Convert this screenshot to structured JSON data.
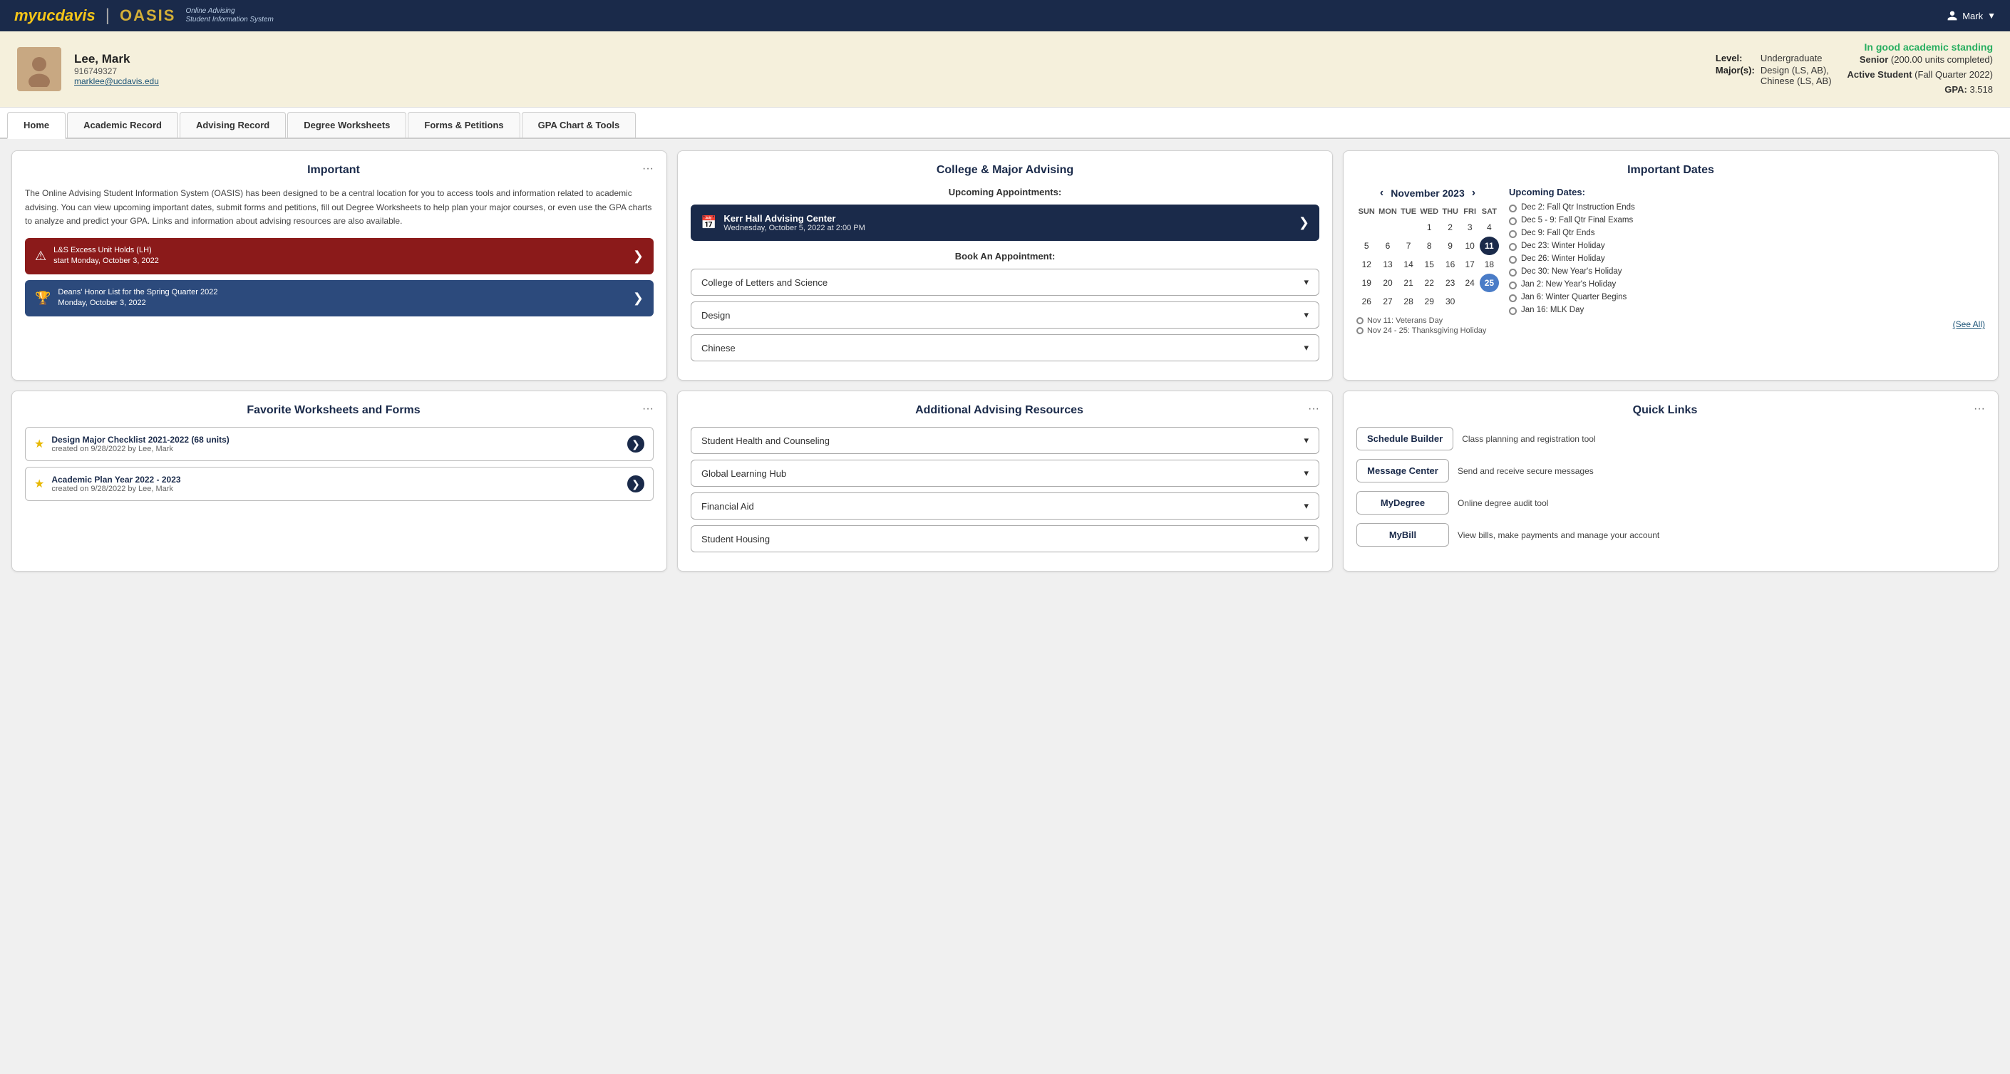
{
  "topnav": {
    "logo_my": "my",
    "logo_ucdavis": "ucdavis",
    "logo_oasis": "OASIS",
    "logo_subtitle_line1": "Online Advising",
    "logo_subtitle_line2": "Student Information System",
    "user_label": "Mark",
    "user_icon": "person-icon"
  },
  "profile": {
    "name": "Lee, Mark",
    "id": "916749327",
    "email": "marklee@ucdavis.edu",
    "level_label": "Level:",
    "level_value": "Undergraduate",
    "majors_label": "Major(s):",
    "majors_value1": "Design (LS, AB),",
    "majors_value2": "Chinese (LS, AB)",
    "standing": "In good academic standing",
    "year": "Senior",
    "units": "(200.00 units completed)",
    "active_label": "Active Student",
    "active_value": "(Fall Quarter 2022)",
    "gpa_label": "GPA:",
    "gpa_value": "3.518"
  },
  "tabs": [
    {
      "label": "Home",
      "active": true
    },
    {
      "label": "Academic Record",
      "active": false
    },
    {
      "label": "Advising Record",
      "active": false
    },
    {
      "label": "Degree Worksheets",
      "active": false
    },
    {
      "label": "Forms & Petitions",
      "active": false
    },
    {
      "label": "GPA Chart & Tools",
      "active": false
    }
  ],
  "important_card": {
    "title": "Important",
    "menu": "···",
    "body": "The Online Advising Student Information System (OASIS) has been designed to be a central location for you to access tools and information related to academic advising. You can view upcoming important dates, submit forms and petitions, fill out Degree Worksheets to help plan your major courses, or even use the GPA charts to analyze and predict your GPA. Links and information about advising resources are also available.",
    "alert_label": "L&S Excess Unit Holds (LH)",
    "alert_sub": "start Monday, October 3, 2022",
    "honor_label": "Deans' Honor List for the Spring Quarter 2022",
    "honor_sub": "Monday, October 3, 2022"
  },
  "college_advising": {
    "title": "College & Major Advising",
    "upcoming_title": "Upcoming Appointments:",
    "appointment_name": "Kerr Hall Advising Center",
    "appointment_date": "Wednesday, October 5, 2022 at 2:00 PM",
    "book_title": "Book An Appointment:",
    "dropdown1": "College of Letters and Science",
    "dropdown2": "Design",
    "dropdown3": "Chinese"
  },
  "important_dates": {
    "title": "Important Dates",
    "cal_month": "November 2023",
    "cal_days_header": [
      "SUN",
      "MON",
      "TUE",
      "WED",
      "THU",
      "FRI",
      "SAT"
    ],
    "cal_weeks": [
      [
        null,
        null,
        null,
        "1",
        "2",
        "3",
        "4",
        "5"
      ],
      [
        "6",
        "7",
        "8",
        "9",
        "10",
        "11",
        "12"
      ],
      [
        "13",
        "14",
        "15",
        "16",
        "17",
        "18",
        "19"
      ],
      [
        "20",
        "21",
        "22",
        "23",
        "24",
        "25",
        "26"
      ],
      [
        "27",
        "28",
        "29",
        "30",
        null,
        null,
        null
      ]
    ],
    "today": "11",
    "highlighted": "25",
    "holidays": [
      "Nov 11: Veterans Day",
      "Nov 24 - 25: Thanksgiving Holiday"
    ],
    "upcoming_title": "Upcoming Dates:",
    "upcoming_items": [
      "Dec 2: Fall Qtr Instruction Ends",
      "Dec 5 - 9: Fall Qtr Final Exams",
      "Dec 9: Fall Qtr Ends",
      "Dec 23: Winter Holiday",
      "Dec 26: Winter Holiday",
      "Dec 30: New Year's Holiday",
      "Jan 2: New Year's Holiday",
      "Jan 6: Winter Quarter Begins",
      "Jan 16: MLK Day"
    ],
    "see_all": "(See All)"
  },
  "worksheets": {
    "title": "Favorite Worksheets and Forms",
    "menu": "···",
    "items": [
      {
        "name": "Design Major Checklist 2021-2022 (68 units)",
        "date": "created on 9/28/2022 by Lee, Mark"
      },
      {
        "name": "Academic Plan Year 2022 - 2023",
        "date": "created on 9/28/2022 by Lee, Mark"
      }
    ]
  },
  "advising_resources": {
    "title": "Additional Advising Resources",
    "menu": "···",
    "items": [
      "Student Health and Counseling",
      "Global Learning Hub",
      "Financial Aid",
      "Student Housing"
    ]
  },
  "quick_links": {
    "title": "Quick Links",
    "menu": "···",
    "items": [
      {
        "label": "Schedule Builder",
        "desc": "Class planning and registration tool"
      },
      {
        "label": "Message Center",
        "desc": "Send and receive secure messages"
      },
      {
        "label": "MyDegree",
        "desc": "Online degree audit tool"
      },
      {
        "label": "MyBill",
        "desc": "View bills, make payments and manage your account"
      }
    ]
  }
}
